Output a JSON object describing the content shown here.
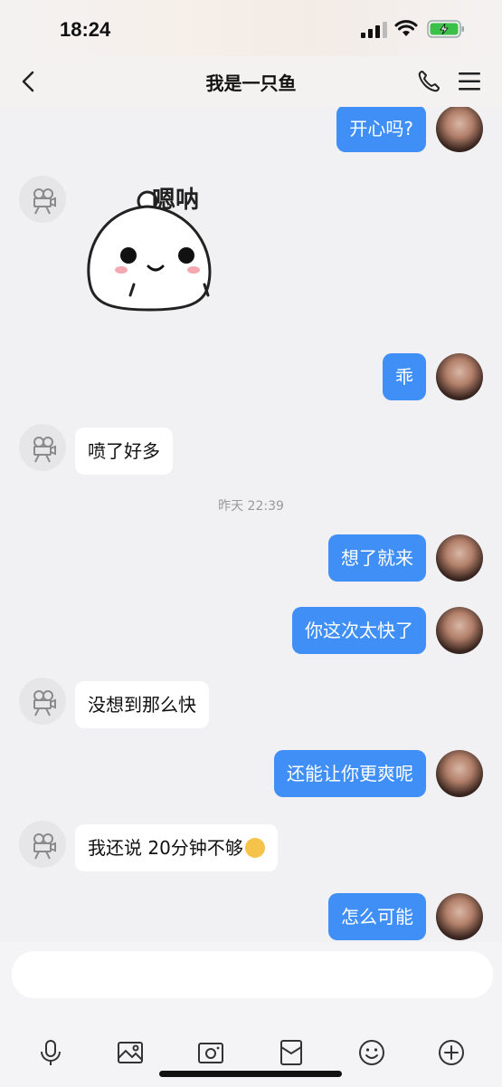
{
  "status": {
    "time": "18:24"
  },
  "header": {
    "title": "我是一只鱼"
  },
  "messages": {
    "m1": "开心吗?",
    "sticker_text": "嗯呐",
    "m2": "乖",
    "m3": "喷了好多",
    "timestamp": "昨天 22:39",
    "m4": "想了就来",
    "m5": "你这次太快了",
    "m6": "没想到那么快",
    "m7": "还能让你更爽呢",
    "m8": "我还说 20分钟不够",
    "m9": "怎么可能"
  },
  "colors": {
    "bubble_me": "#3f8ff6",
    "bubble_peer": "#ffffff",
    "background": "#f1f1f3"
  },
  "toolbar": {
    "icons": [
      "microphone-icon",
      "image-icon",
      "camera-icon",
      "red-envelope-icon",
      "emoji-icon",
      "plus-icon"
    ]
  }
}
